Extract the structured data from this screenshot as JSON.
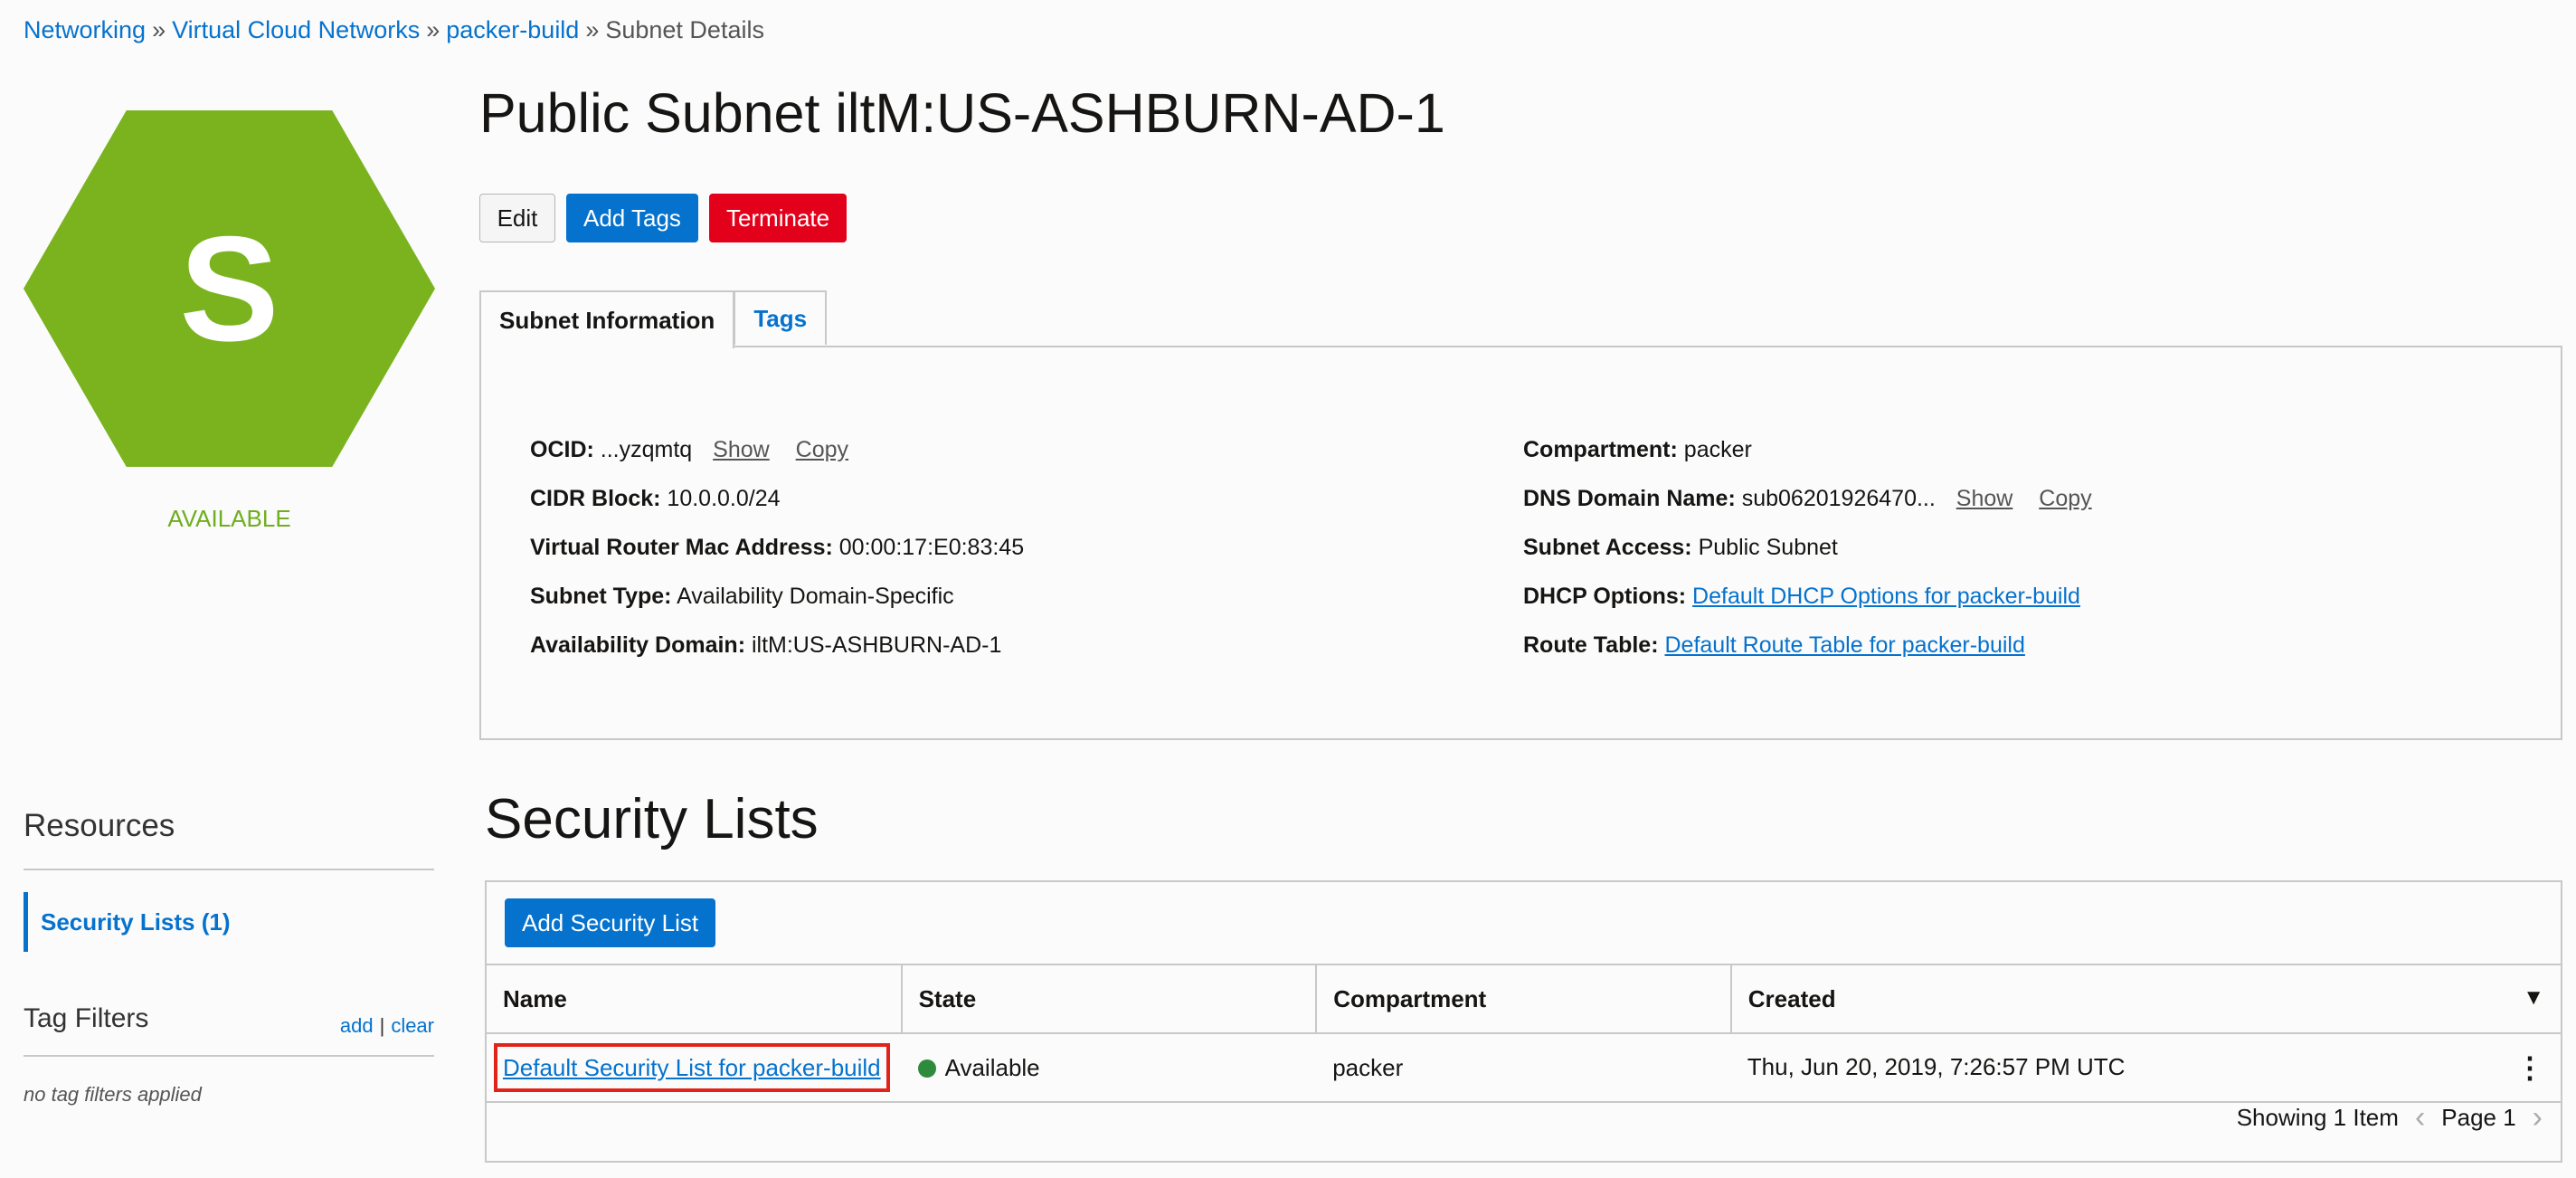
{
  "breadcrumb": {
    "items": [
      "Networking",
      "Virtual Cloud Networks",
      "packer-build"
    ],
    "separator": "»",
    "current": "Subnet Details"
  },
  "resource_icon": {
    "letter": "S",
    "status": "AVAILABLE",
    "color": "#7ab31e"
  },
  "page_title": "Public Subnet iltM:US-ASHBURN-AD-1",
  "actions": {
    "edit": "Edit",
    "add_tags": "Add Tags",
    "terminate": "Terminate"
  },
  "tabs": [
    "Subnet Information",
    "Tags"
  ],
  "subnet_info": {
    "left": [
      {
        "label": "OCID:",
        "value": "...yzqmtq",
        "show": "Show",
        "copy": "Copy"
      },
      {
        "label": "CIDR Block:",
        "value": "10.0.0.0/24"
      },
      {
        "label": "Virtual Router Mac Address:",
        "value": "00:00:17:E0:83:45"
      },
      {
        "label": "Subnet Type:",
        "value": "Availability Domain-Specific"
      },
      {
        "label": "Availability Domain:",
        "value": "iltM:US-ASHBURN-AD-1"
      }
    ],
    "right": [
      {
        "label": "Compartment:",
        "value": "packer"
      },
      {
        "label": "DNS Domain Name:",
        "value": "sub06201926470...",
        "show": "Show",
        "copy": "Copy"
      },
      {
        "label": "Subnet Access:",
        "value": "Public Subnet"
      },
      {
        "label": "DHCP Options:",
        "link": "Default DHCP Options for packer-build"
      },
      {
        "label": "Route Table:",
        "link": "Default Route Table for packer-build"
      }
    ]
  },
  "resources": {
    "title": "Resources",
    "items": [
      "Security Lists (1)"
    ],
    "tag_filters": {
      "title": "Tag Filters",
      "add": "add",
      "separator": "|",
      "clear": "clear",
      "empty": "no tag filters applied"
    }
  },
  "security_lists": {
    "title": "Security Lists",
    "add_button": "Add Security List",
    "columns": [
      "Name",
      "State",
      "Compartment",
      "Created"
    ],
    "rows": [
      {
        "name": "Default Security List for packer-build",
        "state": "Available",
        "compartment": "packer",
        "created": "Thu, Jun 20, 2019, 7:26:57 PM UTC"
      }
    ],
    "footer": {
      "showing": "Showing 1 Item",
      "page": "Page 1"
    },
    "highlight_color": "#e2231a",
    "state_color": "#2e8b3d"
  },
  "icons": {
    "sort": "sort-descending-icon",
    "kebab": "kebab-menu-icon",
    "prev": "chevron-left-icon",
    "next": "chevron-right-icon"
  }
}
